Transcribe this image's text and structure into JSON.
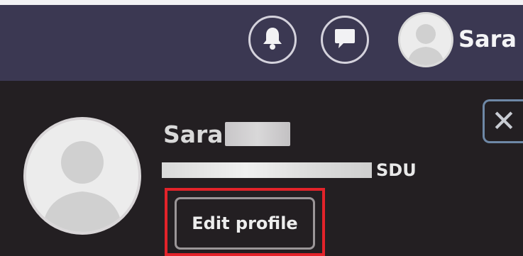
{
  "header": {
    "username": "Sara",
    "icons": [
      "bell-icon",
      "chat-icon",
      "avatar-icon"
    ]
  },
  "profile": {
    "first_name": "Sara",
    "email_suffix": "SDU",
    "edit_button_label": "Edit profile",
    "close_symbol": "✕"
  },
  "colors": {
    "header_bg": "#3b3852",
    "panel_bg": "#231f22",
    "highlight": "#e3232a",
    "close_border": "#6e88a6"
  }
}
